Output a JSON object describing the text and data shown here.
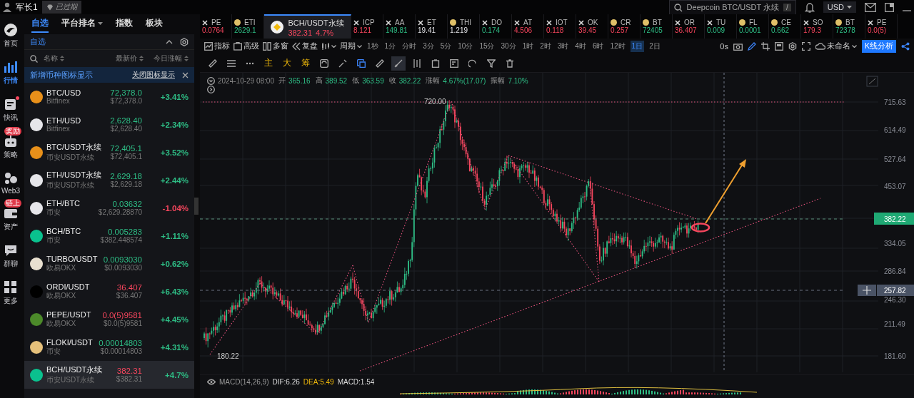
{
  "top_bar": {
    "user": "军长1",
    "badge": "已过期",
    "search": {
      "value": "Deepcoin BTC/USDT 永续",
      "key": "/"
    },
    "currency": "USD"
  },
  "nav": [
    {
      "kind": "logo",
      "label": "首页",
      "selected": false,
      "unread": false
    },
    {
      "kind": "market",
      "label": "行情",
      "selected": true,
      "unread": false
    },
    {
      "kind": "news",
      "label": "快讯",
      "selected": false,
      "unread": true
    },
    {
      "kind": "bot",
      "label": "策略",
      "selected": false,
      "unread": false,
      "badge": "奖励"
    },
    {
      "kind": "web3",
      "label": "Web3",
      "selected": false,
      "unread": false
    },
    {
      "kind": "wallet",
      "label": "资产",
      "selected": false,
      "unread": false,
      "badge": "链上"
    },
    {
      "kind": "chat",
      "label": "群聊",
      "selected": false,
      "unread": false
    },
    {
      "kind": "more",
      "label": "更多",
      "selected": false,
      "unread": false
    }
  ],
  "watchlist": {
    "tabs": [
      {
        "label": "自选",
        "selected": true,
        "dropdown": false
      },
      {
        "label": "平台排名",
        "selected": false,
        "dropdown": true
      },
      {
        "label": "指数",
        "selected": false,
        "dropdown": false
      },
      {
        "label": "板块",
        "selected": false,
        "dropdown": false
      }
    ],
    "group": "自选",
    "columns": [
      "名称",
      "最新价",
      "今日涨幅"
    ],
    "banner": {
      "text": "新增币种图标显示",
      "action": "关闭图标显示"
    },
    "rows": [
      {
        "symbol": "BTC/USD",
        "exchange": "Bitfinex",
        "price": "72,378.0",
        "usd_price": "$72,378.0",
        "change": "+3.41%",
        "price_up": true,
        "change_up": true,
        "color": "#e8901a",
        "selected": false
      },
      {
        "symbol": "ETH/USD",
        "exchange": "Bitfinex",
        "price": "2,628.40",
        "usd_price": "$2,628.40",
        "change": "+2.34%",
        "price_up": true,
        "change_up": true,
        "color": "#e6e6ea",
        "selected": false
      },
      {
        "symbol": "BTC/USDT永续",
        "exchange": "币安USDT永续",
        "price": "72,405.1",
        "usd_price": "$72,405.1",
        "change": "+3.52%",
        "price_up": true,
        "change_up": true,
        "color": "#e8901a",
        "selected": false
      },
      {
        "symbol": "ETH/USDT永续",
        "exchange": "币安USDT永续",
        "price": "2,629.18",
        "usd_price": "$2,629.18",
        "change": "+2.44%",
        "price_up": true,
        "change_up": true,
        "color": "#e6e6ea",
        "selected": false
      },
      {
        "symbol": "ETH/BTC",
        "exchange": "币安",
        "price": "0.03632",
        "usd_price": "$2,629.28870",
        "change": "-1.04%",
        "price_up": true,
        "change_up": false,
        "color": "#e6e6ea",
        "selected": false
      },
      {
        "symbol": "BCH/BTC",
        "exchange": "币安",
        "price": "0.005283",
        "usd_price": "$382.448574",
        "change": "+1.11%",
        "price_up": true,
        "change_up": true,
        "color": "#0ac18e",
        "selected": false
      },
      {
        "symbol": "TURBO/USDT",
        "exchange": "欧易OKX",
        "price": "0.0093030",
        "usd_price": "$0.0093030",
        "change": "+0.62%",
        "price_up": true,
        "change_up": true,
        "color": "#e8e0d0",
        "selected": false
      },
      {
        "symbol": "ORDI/USDT",
        "exchange": "欧易OKX",
        "price": "36.407",
        "usd_price": "$36.407",
        "change": "+6.43%",
        "price_up": false,
        "change_up": true,
        "color": "#000000",
        "selected": false
      },
      {
        "symbol": "PEPE/USDT",
        "exchange": "欧易OKX",
        "price": "0.0(5)9581",
        "usd_price": "$0.0(5)9581",
        "change": "+4.45%",
        "price_up": false,
        "change_up": true,
        "color": "#4c8a2a",
        "selected": false
      },
      {
        "symbol": "FLOKI/USDT",
        "exchange": "币安",
        "price": "0.00014803",
        "usd_price": "$0.00014803",
        "change": "+4.31%",
        "price_up": true,
        "change_up": true,
        "color": "#e5c07b",
        "selected": false
      },
      {
        "symbol": "BCH/USDT永续",
        "exchange": "币安USDT永续",
        "price": "382.31",
        "usd_price": "$382.31",
        "change": "+4.7%",
        "price_up": false,
        "change_up": true,
        "color": "#0ac18e",
        "selected": true
      }
    ]
  },
  "ticker": [
    {
      "kind": "cross",
      "symbol": "PE",
      "price": "0.0764",
      "up": false,
      "neutral": false,
      "selected": false
    },
    {
      "kind": "coin",
      "symbol": "ETI",
      "price": "2629.1",
      "up": true,
      "neutral": false,
      "selected": false
    },
    {
      "kind": "coin",
      "symbol": "BCH/USDT永续",
      "price": "382.31",
      "change": "4.7%",
      "up": false,
      "neutral": false,
      "selected": true
    },
    {
      "kind": "cross",
      "symbol": "ICP",
      "price": "8.121",
      "up": false,
      "neutral": false,
      "selected": false
    },
    {
      "kind": "cross",
      "symbol": "AA",
      "price": "149.81",
      "up": true,
      "neutral": false,
      "selected": false
    },
    {
      "kind": "cross",
      "symbol": "ET",
      "price": "19.41",
      "up": true,
      "neutral": true,
      "selected": false
    },
    {
      "kind": "coin",
      "symbol": "THI",
      "price": "1.219",
      "up": true,
      "neutral": true,
      "selected": false
    },
    {
      "kind": "cross",
      "symbol": "DO",
      "price": "0.174",
      "up": true,
      "neutral": false,
      "selected": false
    },
    {
      "kind": "cross",
      "symbol": "AT",
      "price": "4.506",
      "up": false,
      "neutral": false,
      "selected": false
    },
    {
      "kind": "cross",
      "symbol": "IOT",
      "price": "0.118",
      "up": false,
      "neutral": false,
      "selected": false
    },
    {
      "kind": "cross",
      "symbol": "OK",
      "price": "39.45",
      "up": false,
      "neutral": false,
      "selected": false
    },
    {
      "kind": "coin",
      "symbol": "CR",
      "price": "0.257",
      "up": false,
      "neutral": false,
      "selected": false
    },
    {
      "kind": "coin",
      "symbol": "BT",
      "price": "72405",
      "up": true,
      "neutral": false,
      "selected": false
    },
    {
      "kind": "cross",
      "symbol": "OR",
      "price": "36.407",
      "up": false,
      "neutral": false,
      "selected": false
    },
    {
      "kind": "cross",
      "symbol": "TU",
      "price": "0.009",
      "up": true,
      "neutral": false,
      "selected": false
    },
    {
      "kind": "coin",
      "symbol": "FL",
      "price": "0.0001",
      "up": true,
      "neutral": false,
      "selected": false
    },
    {
      "kind": "coin",
      "symbol": "CE",
      "price": "0.662",
      "up": true,
      "neutral": false,
      "selected": false
    },
    {
      "kind": "cross",
      "symbol": "SO",
      "price": "179.3",
      "up": false,
      "neutral": false,
      "selected": false
    },
    {
      "kind": "coin",
      "symbol": "BT",
      "price": "72378",
      "up": true,
      "neutral": false,
      "selected": false
    },
    {
      "kind": "cross",
      "symbol": "PE",
      "price": "0.0(5)",
      "up": false,
      "neutral": false,
      "selected": false
    }
  ],
  "toolbar": {
    "tools": [
      {
        "kind": "indicator",
        "label": "指标"
      },
      {
        "kind": "advanced",
        "label": "高级"
      },
      {
        "kind": "window",
        "label": "多窗"
      },
      {
        "kind": "replay",
        "label": "复盘"
      }
    ],
    "period_label": "周期",
    "periods": [
      {
        "label": "1秒",
        "selected": false
      },
      {
        "label": "1分",
        "selected": false
      },
      {
        "label": "分时",
        "selected": false
      },
      {
        "label": "3分",
        "selected": false
      },
      {
        "label": "5分",
        "selected": false
      },
      {
        "label": "10分",
        "selected": false
      },
      {
        "label": "15分",
        "selected": false
      },
      {
        "label": "30分",
        "selected": false
      },
      {
        "label": "1时",
        "selected": false
      },
      {
        "label": "2时",
        "selected": false
      },
      {
        "label": "3时",
        "selected": false
      },
      {
        "label": "4时",
        "selected": false
      },
      {
        "label": "6时",
        "selected": false
      },
      {
        "label": "12时",
        "selected": false
      },
      {
        "label": "1日",
        "selected": true
      },
      {
        "label": "2日",
        "selected": false
      }
    ],
    "countdown": "0s",
    "layout_name": "未命名",
    "analysis_button": "K线分析"
  },
  "drawing_toolbar": {
    "overlays": [
      "主",
      "大",
      "筹"
    ]
  },
  "chart": {
    "info": {
      "datetime": "2024-10-29 08:00",
      "fields": [
        {
          "label": "开",
          "value": "365.16"
        },
        {
          "label": "高",
          "value": "389.52"
        },
        {
          "label": "低",
          "value": "363.59"
        },
        {
          "label": "收",
          "value": "382.22"
        },
        {
          "label": "涨幅",
          "value": "4.67%(17.07)"
        },
        {
          "label": "振幅",
          "value": "7.10%"
        }
      ]
    },
    "price_labels": [
      "715.63",
      "614.49",
      "527.64",
      "453.07",
      "334.05",
      "286.84",
      "246.30",
      "211.49",
      "181.60"
    ],
    "last_price": "382.22",
    "cursor_price": "257.82",
    "high_label": "720.00",
    "low_label": "180.22"
  },
  "macd": {
    "title": "MACD(14,26,9)",
    "dif": "DIF:6.26",
    "dea": "DEA:5.49",
    "macd": "MACD:1.54"
  }
}
